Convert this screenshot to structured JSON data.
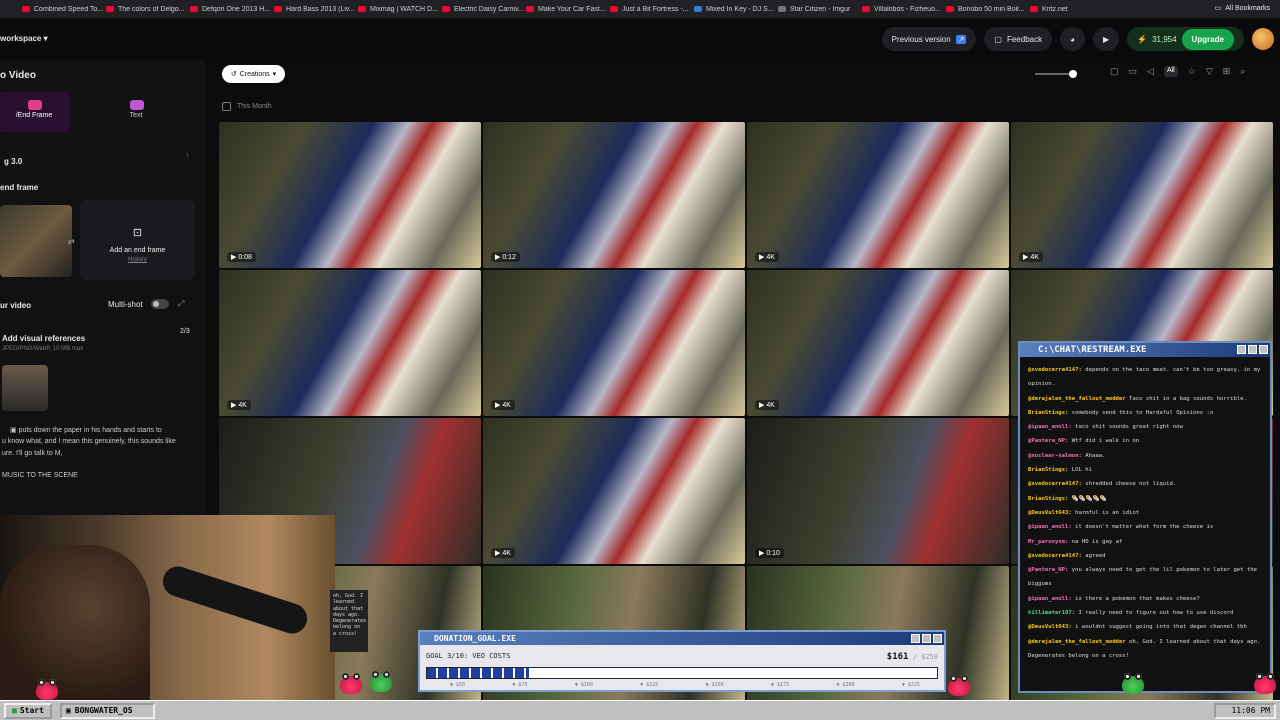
{
  "bookmarks": [
    {
      "label": "Combined Speed To...",
      "color": "red"
    },
    {
      "label": "The colors of Delgo...",
      "color": "red"
    },
    {
      "label": "Defqon One 2013 H...",
      "color": "red"
    },
    {
      "label": "Hard Bass 2013 (Liv...",
      "color": "red"
    },
    {
      "label": "Mixmag | WATCH D...",
      "color": "red"
    },
    {
      "label": "Electric Daisy Carniv...",
      "color": "red"
    },
    {
      "label": "Make Your Car Fast...",
      "color": "red"
    },
    {
      "label": "Just a Bit Fortress -...",
      "color": "red"
    },
    {
      "label": "Mixed In Key - DJ S...",
      "color": "blue"
    },
    {
      "label": "Star Citizen - Imgur",
      "color": "white"
    },
    {
      "label": "Villalobos - Fizheuo...",
      "color": "red"
    },
    {
      "label": "Bonobo 50 min Boil...",
      "color": "red"
    },
    {
      "label": "Kritz.net",
      "color": "red"
    }
  ],
  "all_bookmarks": "All Bookmarks",
  "header": {
    "workspace": "workspace",
    "previous_version": "Previous version",
    "feedback": "Feedback",
    "credits": "31,954",
    "upgrade": "Upgrade"
  },
  "left": {
    "title": "o Video",
    "tab_frames": "/End Frame",
    "tab_text": "Text",
    "model": "g 3.0",
    "end_frame": "end frame",
    "add_end_frame": "Add an end frame",
    "history": "History",
    "your_video": "ur video",
    "multi_shot": "Multi-shot",
    "add_refs": "Add visual references",
    "refs_count": "2/3",
    "formats": "JPEG/PNG/WebP, 10 MB max",
    "prompt_line1": "puts down the paper in his hands and starts to",
    "prompt_line2": "u know what, and I mean this genuinely, this sounds like",
    "prompt_line3": "ure. I'll go talk to M,",
    "prompt_line4": "MUSIC TO THE SCENE"
  },
  "toolbar": {
    "creations": "Creations",
    "all": "All",
    "this_month": "This Month"
  },
  "tiles": [
    {
      "badge": "0:08",
      "kind": "us"
    },
    {
      "badge": "0:12",
      "kind": "us"
    },
    {
      "badge": "4K",
      "kind": "us"
    },
    {
      "badge": "4K",
      "kind": "us"
    },
    {
      "badge": "4K",
      "kind": "us"
    },
    {
      "badge": "4K",
      "kind": "us"
    },
    {
      "badge": "4K",
      "kind": "us"
    },
    {
      "badge": "",
      "kind": "us"
    },
    {
      "badge": "",
      "kind": "dark"
    },
    {
      "badge": "4K",
      "kind": "us"
    },
    {
      "badge": "0:10",
      "kind": "dark"
    },
    {
      "badge": "",
      "kind": "dark"
    },
    {
      "badge": "",
      "kind": "sol"
    },
    {
      "badge": "",
      "kind": "sol"
    },
    {
      "badge": "",
      "kind": "sol"
    },
    {
      "badge": "",
      "kind": "sol"
    }
  ],
  "speech": "oh, God. I learned about that days ago. Degenerates belong on a cross!",
  "chat": {
    "title": "C:\\CHAT\\RESTREAM.EXE",
    "messages": [
      {
        "user": "@svedocerra4147:",
        "text": "depends on the taco meat. can't be too greasy. in my opinion.",
        "c": "c4"
      },
      {
        "user": "@derajalen_the_fallout_modder",
        "text": "Taco shit in a bag sounds horrible.",
        "c": "c4"
      },
      {
        "user": "BrianStings:",
        "text": "somebody send this to Hardaful Opinions :o",
        "c": "c4"
      },
      {
        "user": "@ipaan_anoll:",
        "text": "taco shit sounds great right now",
        "c": "c2"
      },
      {
        "user": "@Pantera_NP:",
        "text": "Wtf did i walk in on",
        "c": "c2"
      },
      {
        "user": "@nuclear-salmon:",
        "text": "Ahaaa.",
        "c": "c2"
      },
      {
        "user": "BrianStings:",
        "text": "LOL hi",
        "c": "c4"
      },
      {
        "user": "@svedocerra4147:",
        "text": "shredded cheese not liquid.",
        "c": "c4"
      },
      {
        "user": "BrianStings:",
        "text": "🌯🌯🌯🌯🌯",
        "c": "c4"
      },
      {
        "user": "@DeusVult643:",
        "text": "harmful is an idiot",
        "c": "c4"
      },
      {
        "user": "@ipaan_anoll:",
        "text": "it doesn't matter what form the cheese is",
        "c": "c2"
      },
      {
        "user": "Mr_paroxysm:",
        "text": "na HO is gay af",
        "c": "c2"
      },
      {
        "user": "@svedocerra4147:",
        "text": "agreed",
        "c": "c4"
      },
      {
        "user": "@Pantera_NP:",
        "text": "you always need to get the lil pokemon to later get the biggums",
        "c": "c2"
      },
      {
        "user": "@ipaan_anoll:",
        "text": "is there a pokemon that makes cheese?",
        "c": "c2"
      },
      {
        "user": "killimater107:",
        "text": "I really need to figure out how to use discord",
        "c": "c1"
      },
      {
        "user": "@DeusVult643:",
        "text": "i wouldnt suggest going into that degen channel tbh",
        "c": "c4"
      },
      {
        "user": "@derajalen_the_fallout_modder",
        "text": "oh, God. I learned about that days ago. Degenerates belong on a cross!",
        "c": "c4"
      }
    ]
  },
  "donation": {
    "title": "DONATION_GOAL.EXE",
    "goal_label": "GOAL 3/10: VEO COSTS",
    "amount": "$161",
    "target": "/ $250",
    "progress": 0.2,
    "ticks": [
      "$50",
      "$75",
      "$100",
      "$125",
      "$150",
      "$175",
      "$200",
      "$225"
    ]
  },
  "taskbar": {
    "start": "Start",
    "task": "BONGWATER_OS",
    "clock": "11:06 PM"
  }
}
